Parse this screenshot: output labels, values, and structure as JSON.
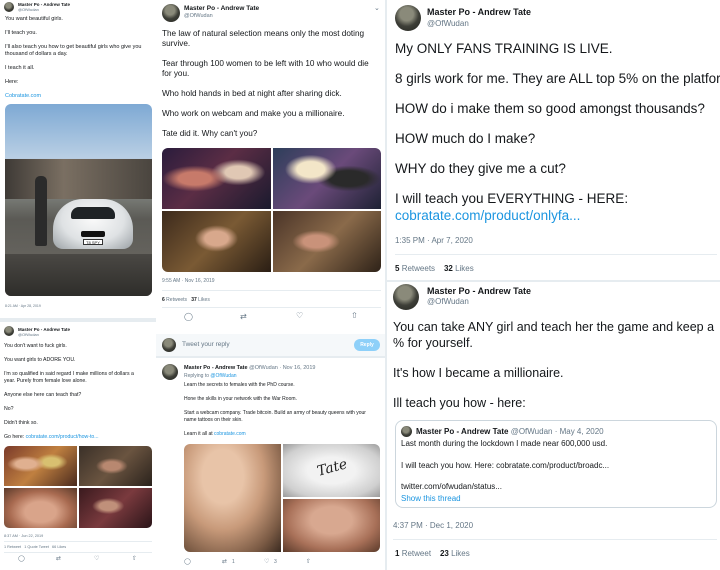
{
  "author": {
    "name": "Master Po - Andrew Tate",
    "handle": "@OfWudan"
  },
  "tweet1": {
    "lines": [
      "You want beautiful girls.",
      "I'll teach you.",
      "I'll also teach you how to get beautiful girls who give you",
      "thousand of dollars a day.",
      "I teach it all.",
      "Here:"
    ],
    "link": "Cobratate.com",
    "car_plate": "T8 SPY",
    "timestamp": "8:21 AM · Apr 28, 2019"
  },
  "tweet2": {
    "lines": [
      "The law of natural selection means only the most doting",
      "survive.",
      "Tear through 100 women to be left with 10 who would die",
      "for you.",
      "Who hold hands in bed at night after sharing dick.",
      "Who work on webcam and make you a millionaire.",
      "Tate did it. Why can't you?"
    ],
    "timestamp": "9:55 AM · Nov 16, 2019",
    "retweets": "6",
    "retweets_label": "Retweets",
    "likes": "37",
    "likes_label": "Likes"
  },
  "reply_box": {
    "placeholder": "Tweet your reply",
    "button": "Reply"
  },
  "tweet3": {
    "lines": [
      "You don't want to fuck girls.",
      "You want girls to ADORE YOU.",
      "I'm so qualified in said regard I make millions of dollars a",
      "year. Purely from female love alone.",
      "Anyone else here can teach that?",
      "No?",
      "Didn't think so."
    ],
    "go_here": "Go here:",
    "link": "cobratate.com/product/how-to...",
    "timestamp": "8:37 AM · Jun 22, 2019",
    "stats": "1 Retweet   1 Quote Tweet   66 Likes"
  },
  "tweet4": {
    "header_meta": "@OfWudan · Nov 16, 2019",
    "replying_prefix": "Replying to",
    "replying_to": "@OfWudan",
    "lines": [
      "Learn the secrets to females with the PhD course.",
      "Hone the skills in your network with the War Room.",
      "Start a webcam company. Trade bitcoin. Build an army of beauty queens with your",
      "name tattoos on their skin."
    ],
    "learn_prefix": "Learn it all at",
    "link": "cobratate.com",
    "tattoo_text": "Tate",
    "retweets": "1",
    "likes": "3"
  },
  "tweet5": {
    "lines": [
      "My ONLY FANS TRAINING IS LIVE.",
      "8 girls work for me. They are ALL top 5% on the platform.",
      "HOW do i make them so good amongst thousands?",
      "HOW much do I make?",
      "WHY do they give me a cut?",
      "I will teach you EVERYTHING - HERE:"
    ],
    "link": "cobratate.com/product/onlyfa...",
    "timestamp": "1:35 PM · Apr 7, 2020",
    "retweets": "5",
    "retweets_label": "Retweets",
    "likes": "32",
    "likes_label": "Likes"
  },
  "tweet6": {
    "lines": [
      "You can take ANY girl and teach her the game and keep a",
      "% for yourself.",
      "It's how I became a millionaire.",
      "Ill teach you how - here:"
    ],
    "quote": {
      "name": "Master Po - Andrew Tate",
      "meta": "@OfWudan · May 4, 2020",
      "line1": "Last month during the lockdown I made near 600,000 usd.",
      "line2": "I will teach you how. Here: cobratate.com/product/broadc...",
      "line3": "twitter.com/ofwudan/status...",
      "show_thread": "Show this thread"
    },
    "timestamp": "4:37 PM · Dec 1, 2020",
    "retweets": "1",
    "retweets_label": "Retweet",
    "likes": "23",
    "likes_label": "Likes"
  },
  "colors": {
    "link": "#1b95e0",
    "muted": "#657786",
    "background": "#e6ecf0"
  }
}
